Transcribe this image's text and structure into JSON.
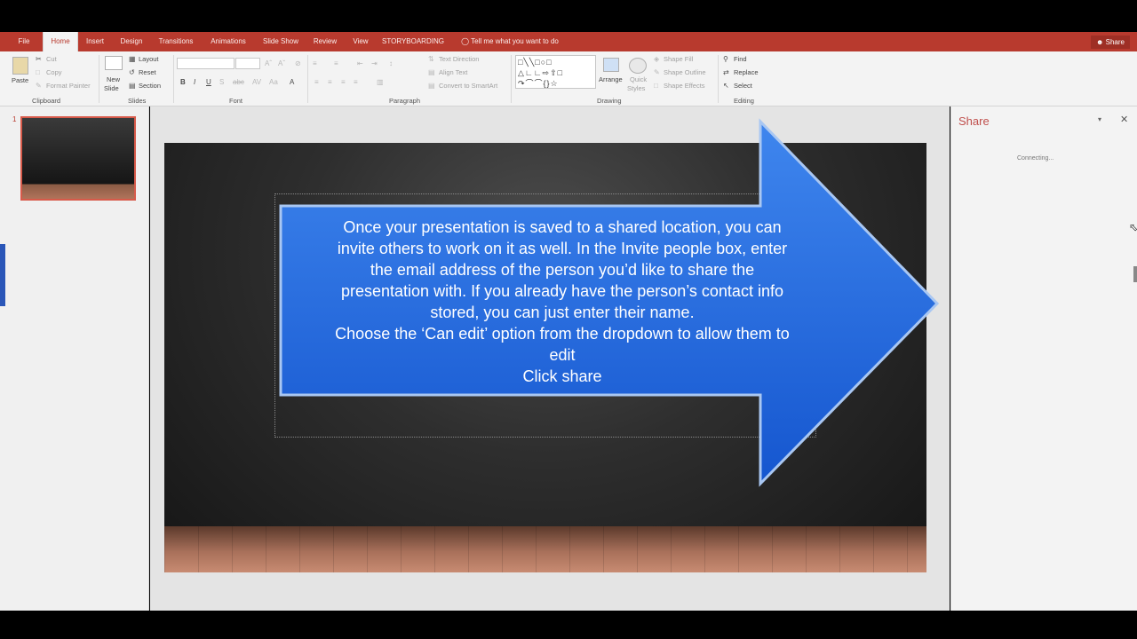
{
  "tabs": [
    "File",
    "Home",
    "Insert",
    "Design",
    "Transitions",
    "Animations",
    "Slide Show",
    "Review",
    "View",
    "STORYBOARDING"
  ],
  "tell_me": "Tell me what you want to do",
  "share_button": "Share",
  "ribbon": {
    "clipboard": {
      "paste": "Paste",
      "cut": "Cut",
      "copy": "Copy",
      "format_painter": "Format Painter",
      "label": "Clipboard"
    },
    "slides": {
      "new": "New",
      "slide": "Slide",
      "layout": "Layout",
      "reset": "Reset",
      "section": "Section",
      "label": "Slides"
    },
    "font": {
      "label": "Font"
    },
    "paragraph": {
      "text_direction": "Text Direction",
      "align_text": "Align Text",
      "convert": "Convert to SmartArt",
      "label": "Paragraph"
    },
    "drawing": {
      "arrange": "Arrange",
      "quick": "Quick",
      "styles": "Styles",
      "shape_fill": "Shape Fill",
      "shape_outline": "Shape Outline",
      "shape_effects": "Shape Effects",
      "label": "Drawing"
    },
    "editing": {
      "find": "Find",
      "replace": "Replace",
      "select": "Select",
      "label": "Editing"
    }
  },
  "thumbnail": {
    "number": "1"
  },
  "slide": {
    "lines": [
      "Once your presentation is saved to a shared location, you can",
      "invite others to work on it as well. In the Invite people box, enter",
      "the email address of the person you’d like to share the",
      "presentation with. If you already have the person’s contact info",
      "stored, you can just enter their name.",
      "Choose the ‘Can edit’ option from the dropdown to allow them to",
      "edit",
      "Click share"
    ]
  },
  "share_pane": {
    "title": "Share",
    "status": "Connecting..."
  },
  "colors": {
    "ribbon_red": "#b83a2e",
    "arrow_blue": "#2c6fe0",
    "pane_title": "#c0504d"
  }
}
